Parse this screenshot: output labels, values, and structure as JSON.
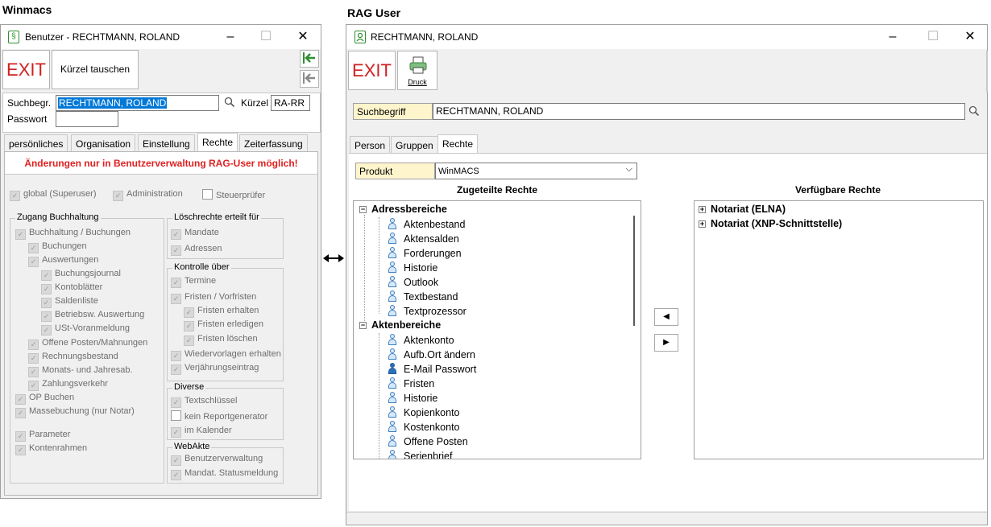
{
  "headings": {
    "left": "Winmacs",
    "right": "RAG User"
  },
  "winmacs": {
    "title": "Benutzer - RECHTMANN, ROLAND",
    "exit_label": "EXIT",
    "swap_label": "Kürzel tauschen",
    "search_label": "Suchbegr.",
    "search_value": "RECHTMANN, ROLAND",
    "kuerzel_label": "Kürzel",
    "kuerzel_value": "RA-RR",
    "password_label": "Passwort",
    "tabs": [
      "persönliches",
      "Organisation",
      "Einstellung",
      "Rechte",
      "Zeiterfassung"
    ],
    "active_tab": "Rechte",
    "warning": "Änderungen nur in Benutzerverwaltung RAG-User möglich!",
    "top_checks": [
      "global (Superuser)",
      "Administration",
      "Steuerprüfer"
    ],
    "zugang": {
      "title": "Zugang Buchhaltung",
      "items": [
        "Buchhaltung  / Buchungen",
        "Buchungen",
        "Auswertungen",
        "Buchungsjournal",
        "Kontoblätter",
        "Saldenliste",
        "Betriebsw. Auswertung",
        "USt-Voranmeldung",
        "Offene Posten/Mahnungen",
        "Rechnungsbestand",
        "Monats- und Jahresab.",
        "Zahlungsverkehr",
        "OP Buchen",
        "Massebuchung (nur Notar)",
        "Parameter",
        "Kontenrahmen"
      ]
    },
    "loesch": {
      "title": "Löschrechte erteilt für",
      "items": [
        "Mandate",
        "Adressen"
      ]
    },
    "kontrolle": {
      "title": "Kontrolle über",
      "items": [
        "Termine",
        "Fristen / Vorfristen",
        "Fristen erhalten",
        "Fristen erledigen",
        "Fristen löschen",
        "Wiedervorlagen erhalten",
        "Verjährungseintrag"
      ]
    },
    "diverse": {
      "title": "Diverse",
      "items": [
        "Textschlüssel",
        "kein Reportgenerator",
        "im Kalender"
      ]
    },
    "webakte": {
      "title": "WebAkte",
      "items": [
        "Benutzerverwaltung",
        "Mandat. Statusmeldung"
      ]
    }
  },
  "rag": {
    "title": "RECHTMANN, ROLAND",
    "exit_label": "EXIT",
    "print_label": "Druck",
    "search_label": "Suchbegriff",
    "search_value": "RECHTMANN, ROLAND",
    "tabs": [
      "Person",
      "Gruppen",
      "Rechte"
    ],
    "active_tab": "Rechte",
    "product_label": "Produkt",
    "product_value": "WinMACS",
    "assigned_header": "Zugeteilte Rechte",
    "available_header": "Verfügbare Rechte",
    "assigned": {
      "group1": "Adressbereiche",
      "group1_items": [
        "Aktenbestand",
        "Aktensalden",
        "Forderungen",
        "Historie",
        "Outlook",
        "Textbestand",
        "Textprozessor"
      ],
      "group2": "Aktenbereiche",
      "group2_items": [
        "Aktenkonto",
        "Aufb.Ort ändern",
        "E-Mail Passwort",
        "Fristen",
        "Historie",
        "Kopienkonto",
        "Kostenkonto",
        "Offene Posten",
        "Serienbrief"
      ]
    },
    "available": [
      "Notariat (ELNA)",
      "Notariat (XNP-Schnittstelle)"
    ]
  },
  "colors": {
    "exit_red": "#d02020",
    "warning_red": "#e02020",
    "label_bg": "#fff5cc",
    "selection": "#0078d7"
  }
}
